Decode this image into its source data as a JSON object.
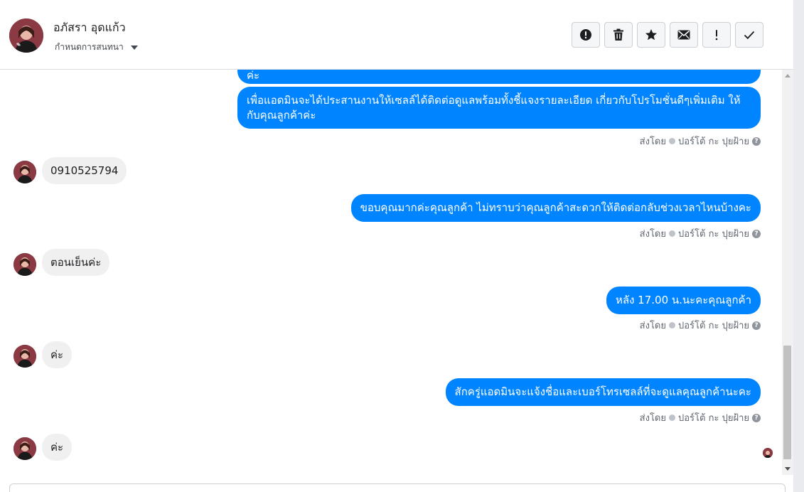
{
  "header": {
    "contact_name": "อภัสรา อุดแก้ว",
    "conversation_settings": "กำหนดการสนทนา",
    "toolbar": [
      {
        "name": "mark-spam-button",
        "icon": "alert-circle-icon"
      },
      {
        "name": "delete-button",
        "icon": "trash-icon"
      },
      {
        "name": "star-button",
        "icon": "star-icon"
      },
      {
        "name": "mark-unread-button",
        "icon": "envelope-icon"
      },
      {
        "name": "important-button",
        "icon": "exclamation-icon"
      },
      {
        "name": "mark-done-button",
        "icon": "check-icon"
      }
    ]
  },
  "messages": [
    {
      "type": "out",
      "text": "ค่ะ"
    },
    {
      "type": "out",
      "text": "เพื่อแอดมินจะได้ประสานงานให้เซลล์ได้ติดต่อดูแลพร้อมทั้งชี้แจงรายละเอียด เกี่ยวกับโปรโมชั่นดีๆเพิ่มเติม ให้กับคุณลูกค้าค่ะ"
    },
    {
      "type": "in",
      "text": "0910525794"
    },
    {
      "type": "out",
      "text": "ขอบคุณมากค่ะคุณลูกค้า ไม่ทราบว่าคุณลูกค้าสะดวกให้ติดต่อกลับช่วงเวลาไหนบ้างคะ"
    },
    {
      "type": "in",
      "text": "ตอนเย็นค่ะ"
    },
    {
      "type": "out",
      "text": "หลัง 17.00 น.นะคะคุณลูกค้า"
    },
    {
      "type": "in",
      "text": "ค่ะ"
    },
    {
      "type": "out",
      "text": "สักครู่แอดมินจะแจ้งชื่อและเบอร์โทรเซลล์ที่จะดูแลคุณลูกค้านะคะ"
    },
    {
      "type": "in",
      "text": "ค่ะ"
    }
  ],
  "sent_by": {
    "label": "ส่งโดย",
    "agent": "ปอร์โต้ กะ ปุยฝ้าย"
  },
  "colors": {
    "outgoing_bubble": "#0084ff",
    "incoming_bubble": "#f1f0f0"
  }
}
